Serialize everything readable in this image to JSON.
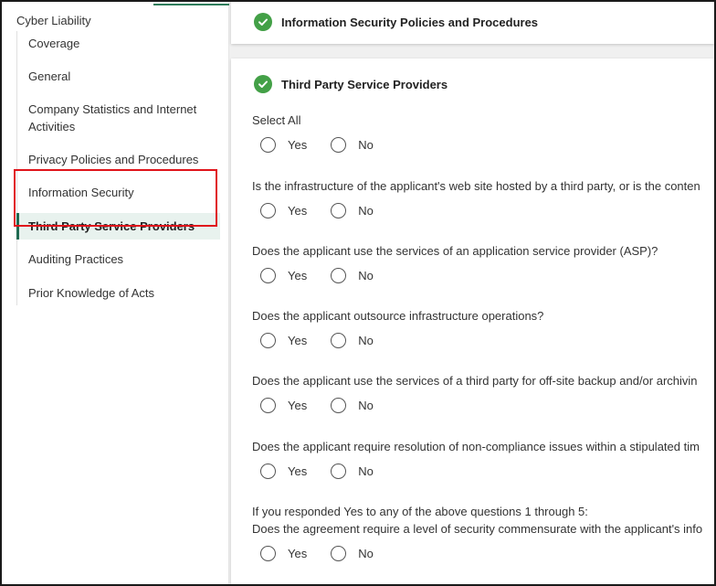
{
  "sidebar": {
    "title": "Cyber Liability",
    "items": [
      {
        "label": "Coverage"
      },
      {
        "label": "General"
      },
      {
        "label": "Company Statistics and Internet Activities"
      },
      {
        "label": "Privacy Policies and Procedures"
      },
      {
        "label": "Information Security"
      },
      {
        "label": "Third Party Service Providers",
        "active": true
      },
      {
        "label": "Auditing Practices"
      },
      {
        "label": "Prior Knowledge of Acts"
      }
    ]
  },
  "main": {
    "previous_section": {
      "title": "Information Security Policies and Procedures"
    },
    "section": {
      "title": "Third Party Service Providers",
      "select_all_label": "Select All",
      "yes_label": "Yes",
      "no_label": "No",
      "questions": [
        {
          "text": "Is the infrastructure of the applicant's web site hosted by a third party, or is the conten"
        },
        {
          "text": "Does the applicant use the services of an application service provider (ASP)?"
        },
        {
          "text": "Does the applicant outsource infrastructure operations?"
        },
        {
          "text": "Does the applicant use the services of a third party for off-site backup and/or archivin"
        },
        {
          "text": "Does the applicant require resolution of non-compliance issues within a stipulated tim"
        },
        {
          "text": "If you responded Yes to any of the above questions 1 through 5:",
          "text2": "Does the agreement require a level of security commensurate with the applicant's info"
        }
      ]
    }
  },
  "colors": {
    "accent_green": "#43a047",
    "active_bg": "#e8f2ee",
    "highlight_red": "#e0141b"
  },
  "icons": [
    "check-circle-icon"
  ]
}
